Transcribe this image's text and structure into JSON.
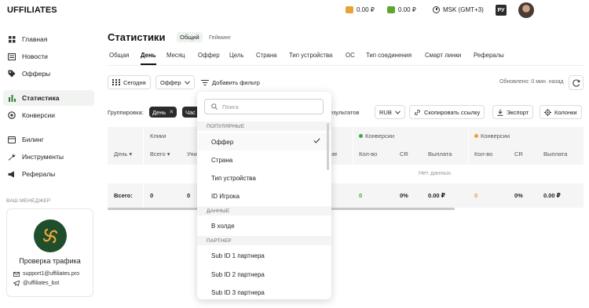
{
  "header": {
    "logo": "UFFILIATES",
    "balance1": "0.00 ₽",
    "balance2": "0.00 ₽",
    "timezone": "MSK (GMT+3)",
    "lang": "РУ",
    "colors": {
      "wallet1": "#e8a23a",
      "wallet2": "#5aa832"
    }
  },
  "sidebar": {
    "items": [
      {
        "label": "Главная",
        "icon": "grid-icon"
      },
      {
        "label": "Новости",
        "icon": "news-icon"
      },
      {
        "label": "Офферы",
        "icon": "tag-icon"
      },
      {
        "label": "Статистика",
        "icon": "bar-chart-icon"
      },
      {
        "label": "Конверсии",
        "icon": "target-icon"
      },
      {
        "label": "Билинг",
        "icon": "billing-icon"
      },
      {
        "label": "Инструменты",
        "icon": "wrench-icon"
      },
      {
        "label": "Рефералы",
        "icon": "megaphone-icon"
      }
    ],
    "manager_title": "ВАШ МЕНЕДЖЕР",
    "manager_name": "Проверка трафика",
    "manager_email": "support1@uffiliates.pro",
    "manager_telegram": "@uffiliates_bot"
  },
  "main": {
    "title": "Статистики",
    "segments": [
      "Общий",
      "Гейминг"
    ],
    "tabs": [
      "Общая",
      "День",
      "Месяц",
      "Оффер",
      "Цель",
      "Страна",
      "Тип устройства",
      "ОС",
      "Тип соединения",
      "Смарт линки",
      "Рефералы"
    ],
    "active_tab": "День",
    "date_button": "Сегодня",
    "offer_select": "Оффер",
    "add_filter": "Добавить фильтр",
    "updated": "Обновлено: 0 мин. назад",
    "grouping_label": "Группировка:",
    "grouping_chips": [
      "День",
      "Час"
    ],
    "results_text": "езультатов",
    "currency": "RUB",
    "copy_link": "Скопировать ссылку",
    "export": "Экспорт",
    "columns": "Колонки"
  },
  "table": {
    "day_header": "День",
    "groups": {
      "clicks": "Клики",
      "conv1": "Конверсии",
      "conv2": "Конверсии"
    },
    "sub_headers": {
      "clicks_total": "Всего",
      "clicks_unique": "Уни",
      "clicks_partial": "ие",
      "conv1": [
        "Кол-во",
        "CR",
        "Выплата"
      ],
      "conv2": [
        "Кол-во",
        "CR",
        "Выплата"
      ]
    },
    "no_data": "Нет данных.",
    "total_label": "Всего:",
    "totals": {
      "clicks_total": "0",
      "clicks_unique": "0",
      "conv1": [
        "0",
        "0%",
        "0.00 ₽"
      ],
      "conv2": [
        "0",
        "0%",
        "0.00 ₽"
      ]
    },
    "colors": {
      "conv1": "#3fa845",
      "conv2": "#e8a23a"
    }
  },
  "dropdown": {
    "placeholder": "Поиск",
    "sections": [
      {
        "title": "ПОПУЛЯРНЫЕ",
        "items": [
          "Оффер",
          "Страна",
          "Тип устройства",
          "ID Игрока"
        ]
      },
      {
        "title": "ДАННЫЕ",
        "items": [
          "В холде"
        ]
      },
      {
        "title": "ПАРТНЕР",
        "items": [
          "Sub ID 1 партнера",
          "Sub ID 2 партнера",
          "Sub ID 3 партнера"
        ]
      }
    ],
    "selected": "Оффер"
  }
}
